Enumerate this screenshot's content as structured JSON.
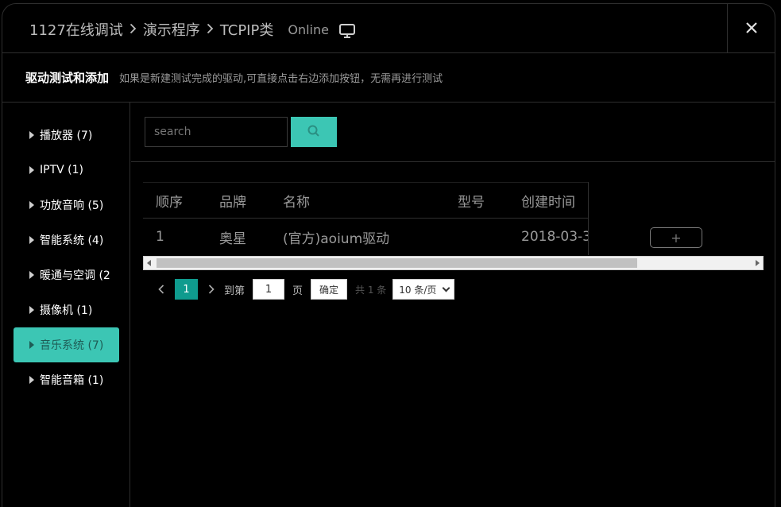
{
  "header": {
    "crumbs": [
      "1127在线调试",
      "演示程序",
      "TCPIP类"
    ],
    "separator": ">",
    "status": "Online"
  },
  "subheader": {
    "title": "驱动测试和添加",
    "hint": "如果是新建测试完成的驱动,可直接点击右边添加按钮，无需再进行测试"
  },
  "sidebar": {
    "items": [
      {
        "label": "播放器 (7)"
      },
      {
        "label": "IPTV (1)"
      },
      {
        "label": "功放音响 (5)"
      },
      {
        "label": "智能系统 (4)"
      },
      {
        "label": "暖通与空调 (2"
      },
      {
        "label": "摄像机 (1)"
      },
      {
        "label": "音乐系统 (7)"
      },
      {
        "label": "智能音箱 (1)"
      }
    ],
    "active_index": 6
  },
  "search": {
    "placeholder": "search"
  },
  "table": {
    "headers": [
      "顺序",
      "品牌",
      "名称",
      "型号",
      "创建时间"
    ],
    "rows": [
      {
        "index": "1",
        "brand": "奥星",
        "name": "(官方)aoium驱动",
        "model": "",
        "created": "2018-03-3"
      }
    ],
    "add_label": "+"
  },
  "pager": {
    "prev": "‹",
    "current": "1",
    "next": "›",
    "goto_label": "到第",
    "goto_value": "1",
    "page_label": "页",
    "ok_label": "确定",
    "total": "共 1 条",
    "per_page": "10 条/页"
  },
  "colors": {
    "accent": "#3cc6b4",
    "active_page": "#0f9b8e",
    "background": "#000000"
  }
}
